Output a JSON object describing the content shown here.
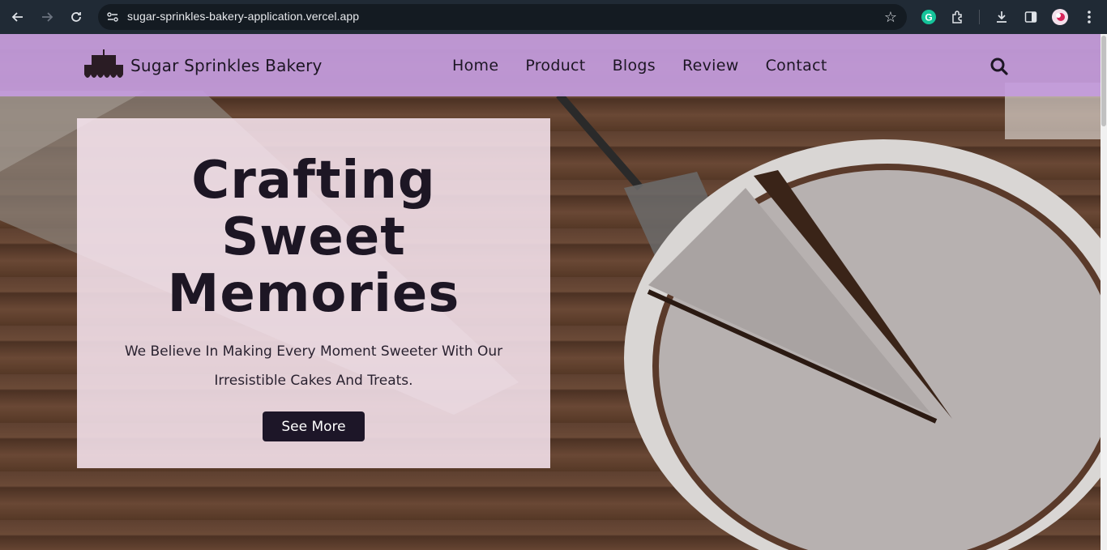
{
  "browser": {
    "url": "sugar-sprinkles-bakery-application.vercel.app",
    "icons": [
      "back-icon",
      "forward-icon",
      "reload-icon",
      "site-settings-icon",
      "bookmark-star-icon",
      "grammarly-icon",
      "extensions-icon",
      "download-icon",
      "side-panel-icon",
      "profile-avatar",
      "more-menu-icon"
    ]
  },
  "header": {
    "brand": "Sugar Sprinkles Bakery",
    "nav": [
      "Home",
      "Product",
      "Blogs",
      "Review",
      "Contact"
    ],
    "background": "#c49cde"
  },
  "hero": {
    "title_lines": [
      "Crafting",
      "Sweet",
      "Memories"
    ],
    "description": "We Believe In Making Every Moment Sweeter With Our Irresistible Cakes And Treats.",
    "cta_label": "See More",
    "cta_color": "#1d1628"
  }
}
